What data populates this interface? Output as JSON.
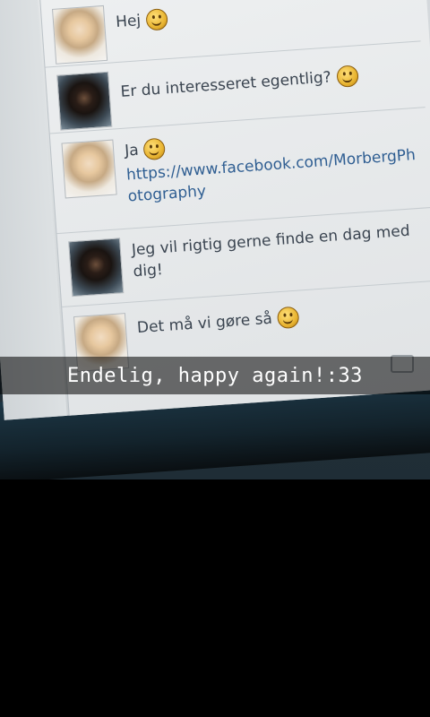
{
  "caption": "Endelig, happy again!:33",
  "messages": [
    {
      "avatar": "blonde",
      "text": "Hej",
      "emoji": "smiley-icon"
    },
    {
      "avatar": "dark",
      "text": "Er du interesseret egentlig?",
      "emoji": "smiley-icon"
    },
    {
      "avatar": "blonde",
      "text": "Ja",
      "emoji": "smiley-icon",
      "link_line1": "https://www.facebook.com/MorbergPh",
      "link_line2": "otography"
    },
    {
      "avatar": "dark",
      "text_line1": "Jeg vil rigtig gerne finde en dag med",
      "text_line2": "dig!"
    },
    {
      "avatar": "blonde",
      "text": "Det må vi gøre så",
      "emoji": "smiley-icon"
    }
  ]
}
